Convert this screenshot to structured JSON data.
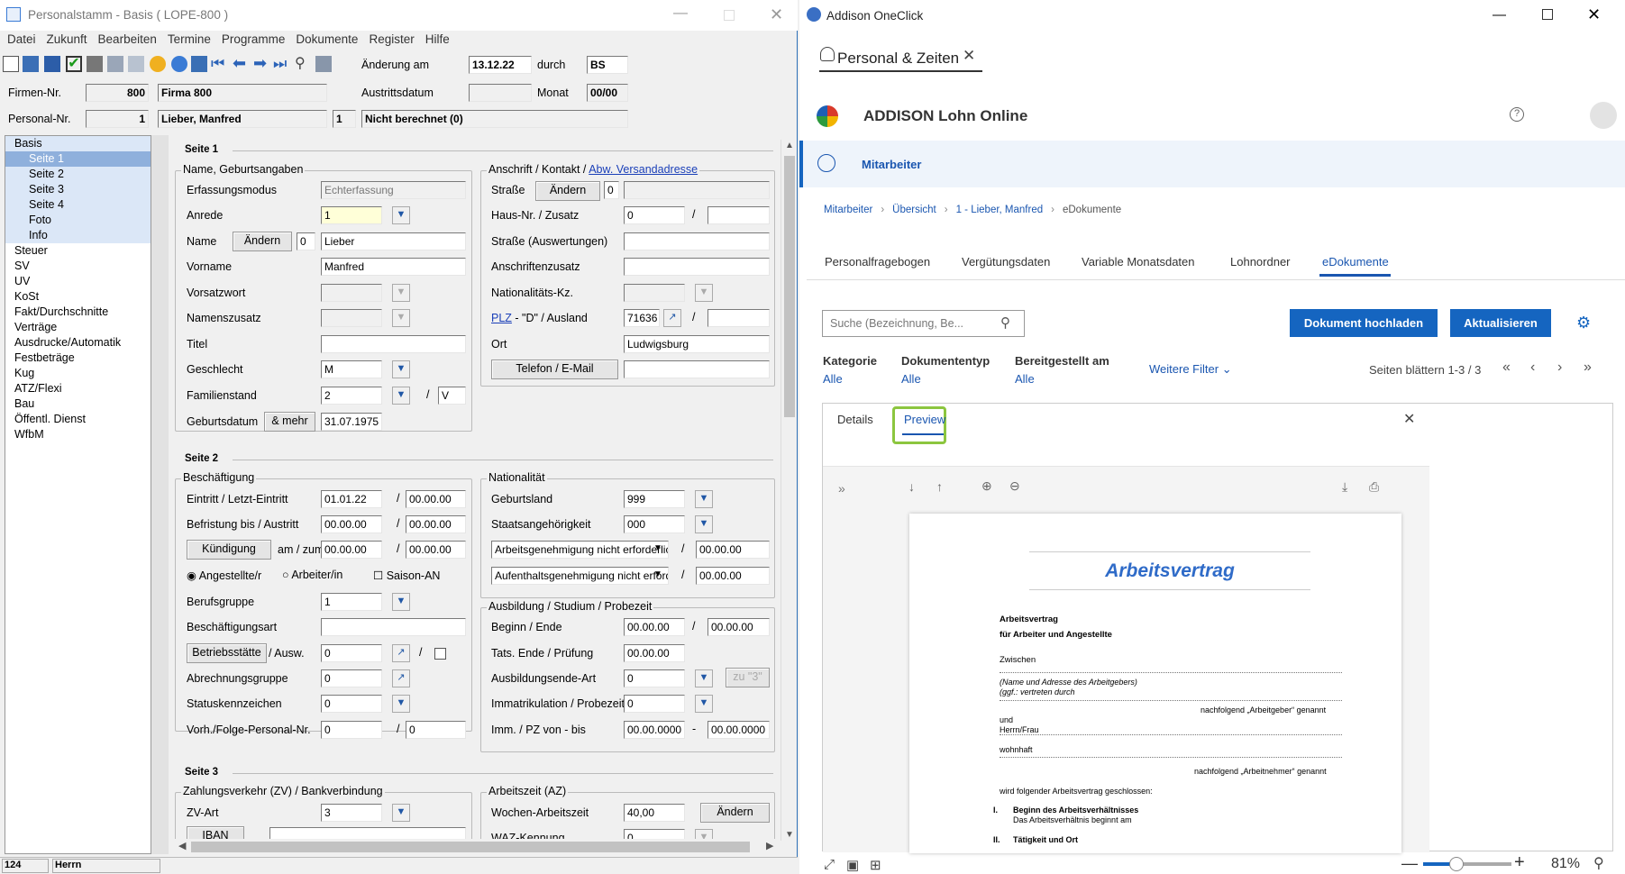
{
  "left": {
    "title": "Personalstamm - Basis  ( LOPE-800 )",
    "menu": [
      "Datei",
      "Zukunft",
      "Bearbeiten",
      "Termine",
      "Programme",
      "Dokumente",
      "Register",
      "Hilfe"
    ],
    "header": {
      "aenderung_label": "Änderung am",
      "aenderung_value": "13.12.22",
      "durch_label": "durch",
      "durch_value": "BS",
      "austritt_label": "Austrittsdatum",
      "monat_label": "Monat",
      "monat_value": "00/00",
      "firmen_label": "Firmen-Nr.",
      "firmen_nr": "800",
      "firmen_name": "Firma 800",
      "personal_label": "Personal-Nr.",
      "personal_nr": "1",
      "personal_name": "Lieber, Manfred",
      "personal_sub": "1",
      "berechnet": "Nicht berechnet (0)"
    },
    "tree": [
      "Basis",
      "Seite 1",
      "Seite 2",
      "Seite 3",
      "Seite 4",
      "Foto",
      "Info",
      "Steuer",
      "SV",
      "UV",
      "KoSt",
      "Fakt/Durchschnitte",
      "Verträge",
      "Ausdrucke/Automatik",
      "Festbeträge",
      "Kug",
      "ATZ/Flexi",
      "Bau",
      "Öffentl. Dienst",
      "WfbM"
    ],
    "seite1": "Seite 1",
    "seite2": "Seite 2",
    "seite3": "Seite 3",
    "name_group": "Name, Geburtsangaben",
    "erfassungsmodus_label": "Erfassungsmodus",
    "erfassungsmodus_value": "Echterfassung",
    "anrede_label": "Anrede",
    "anrede_value": "1",
    "name_label": "Name",
    "aendern": "Ändern",
    "name_zero": "0",
    "name_value": "Lieber",
    "vorname_label": "Vorname",
    "vorname_value": "Manfred",
    "vorsatz_label": "Vorsatzwort",
    "namenszusatz_label": "Namenszusatz",
    "titel_label": "Titel",
    "geschlecht_label": "Geschlecht",
    "geschlecht_value": "M",
    "familienstand_label": "Familienstand",
    "familienstand_value": "2",
    "familienstand_v": "V",
    "geburtsdatum_label": "Geburtsdatum",
    "mehr": "& mehr",
    "geburtsdatum_value": "31.07.1975",
    "anschrift_group": "Anschrift / Kontakt /",
    "abw": "Abw. Versandadresse",
    "strasse_label": "Straße",
    "strasse_zero": "0",
    "hausnr_label": "Haus-Nr. / Zusatz",
    "hausnr_value": "0",
    "strasse_ausw_label": "Straße (Auswertungen)",
    "anschriftenzusatz_label": "Anschriftenzusatz",
    "nat_kz_label": "Nationalitäts-Kz.",
    "plz_link": "PLZ",
    "plz_rest": " - \"D\" / Ausland",
    "plz_value": "71636",
    "ort_label": "Ort",
    "ort_value": "Ludwigsburg",
    "telefon_btn": "Telefon / E-Mail",
    "besch_group": "Beschäftigung",
    "eintritt_label": "Eintritt / Letzt-Eintritt",
    "eintritt_value": "01.01.22",
    "letzt_value": "00.00.00",
    "befristung_label": "Befristung bis / Austritt",
    "befristung_value": "00.00.00",
    "austritt_value": "00.00.00",
    "kuendigung_btn": "Kündigung",
    "amzum_label": "am / zum",
    "kuend_value1": "00.00.00",
    "kuend_value2": "00.00.00",
    "angestellte": "Angestellte/r",
    "arbeiter": "Arbeiter/in",
    "saison": "Saison-AN",
    "berufsgruppe_label": "Berufsgruppe",
    "berufsgruppe_value": "1",
    "beschart_label": "Beschäftigungsart",
    "betriebsstaette_btn": "Betriebsstätte",
    "ausw_label": "/ Ausw.",
    "betrieb_value": "0",
    "abrechnungsgruppe_label": "Abrechnungsgruppe",
    "abrechnungsgruppe_value": "0",
    "status_label": "Statuskennzeichen",
    "status_value": "0",
    "vorh_label": "Vorh./Folge-Personal-Nr.",
    "vorh_value1": "0",
    "vorh_value2": "0",
    "nat_group": "Nationalität",
    "geburtsland_label": "Geburtsland",
    "geburtsland_value": "999",
    "staats_label": "Staatsangehörigkeit",
    "staats_value": "000",
    "arbeitsgen": "Arbeitsgenehmigung nicht erforderlich",
    "arbeitsgen_date": "00.00.00",
    "aufenthalt": "Aufenthaltsgenehmigung nicht erforderlich",
    "aufenthalt_date": "00.00.00",
    "ausb_group": "Ausbildung / Studium / Probezeit",
    "beginn_label": "Beginn / Ende",
    "beginn_value": "00.00.00",
    "ende_value": "00.00.00",
    "tats_label": "Tats. Ende / Prüfung",
    "tats_value": "00.00.00",
    "ausbende_label": "Ausbildungsende-Art",
    "ausbende_value": "0",
    "zu3": "zu \"3\"",
    "imm_label": "Immatrikulation / Probezeit",
    "imm_value": "0",
    "immpz_label": "Imm. / PZ von - bis",
    "immpz_value1": "00.00.0000",
    "immpz_value2": "00.00.0000",
    "zv_group": "Zahlungsverkehr (ZV) / Bankverbindung",
    "zvart_label": "ZV-Art",
    "zvart_value": "3",
    "iban_btn": "IBAN",
    "az_group": "Arbeitszeit (AZ)",
    "wochen_label": "Wochen-Arbeitszeit",
    "wochen_value": "40,00",
    "waz_label": "WAZ-Kennung",
    "waz_value": "0",
    "status_bar": {
      "a": "124",
      "b": "Herrn"
    }
  },
  "right": {
    "window_title": "Addison OneClick",
    "tab": "Personal & Zeiten",
    "app_title": "ADDISON Lohn Online",
    "section": "Mitarbeiter",
    "breadcrumb": [
      "Mitarbeiter",
      "Übersicht",
      "1 - Lieber, Manfred",
      "eDokumente"
    ],
    "tabs": [
      "Personalfragebogen",
      "Vergütungsdaten",
      "Variable Monatsdaten",
      "Lohnordner",
      "eDokumente"
    ],
    "search_placeholder": "Suche (Bezeichnung, Be...",
    "upload_btn": "Dokument hochladen",
    "refresh_btn": "Aktualisieren",
    "filters": [
      {
        "label": "Kategorie",
        "value": "Alle"
      },
      {
        "label": "Dokumententyp",
        "value": "Alle"
      },
      {
        "label": "Bereitgestellt am",
        "value": "Alle"
      }
    ],
    "more_filters": "Weitere Filter",
    "paging": "Seiten blättern 1-3 / 3",
    "detail_tabs": [
      "Details",
      "Preview"
    ],
    "doc": {
      "heading": "Arbeitsvertrag",
      "l1": "Arbeitsvertrag",
      "l2": "für Arbeiter und Angestellte",
      "l3": "Zwischen",
      "l4": "(Name und Adresse des Arbeitgebers)",
      "l5": "(ggf.: vertreten durch",
      "l6": "nachfolgend „Arbeitgeber“ genannt",
      "l7": "und",
      "l8": "Herrn/Frau",
      "l9": "wohnhaft",
      "l10": "nachfolgend „Arbeitnehmer“ genannt",
      "l11": "wird folgender Arbeitsvertrag geschlossen:",
      "l12num": "I.",
      "l12": "Beginn des Arbeitsverhältnisses",
      "l13": "Das Arbeitsverhältnis beginnt am",
      "l14num": "II.",
      "l14": "Tätigkeit und Ort"
    },
    "zoom": "81%"
  }
}
